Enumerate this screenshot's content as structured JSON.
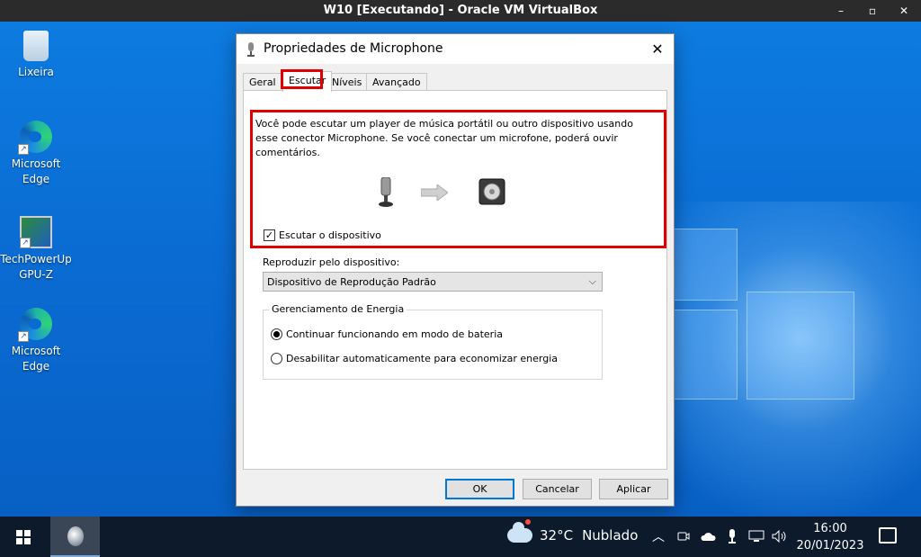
{
  "vbox": {
    "title": "W10 [Executando] - Oracle VM VirtualBox",
    "minimize": "–",
    "maximize": "▫",
    "close": "✕"
  },
  "desktop": {
    "icons": [
      {
        "label": "Lixeira",
        "icon": "recycle-bin-icon"
      },
      {
        "label": "Microsoft Edge",
        "icon": "edge-icon"
      },
      {
        "label": "TechPowerUp GPU-Z",
        "icon": "gpuz-icon"
      },
      {
        "label": "Microsoft Edge",
        "icon": "edge-icon"
      }
    ]
  },
  "dialog": {
    "title": "Propriedades de Microphone",
    "close": "✕",
    "tabs": [
      {
        "label": "Geral",
        "active": false
      },
      {
        "label": "Escutar",
        "active": true
      },
      {
        "label": "Níveis",
        "active": false
      },
      {
        "label": "Avançado",
        "active": false
      }
    ],
    "description": "Você pode escutar um player de música portátil ou outro dispositivo usando esse conector Microphone. Se você conectar um microfone, poderá ouvir comentários.",
    "listen_checkbox": {
      "label": "Escutar o dispositivo",
      "checked": true,
      "mark": "✓"
    },
    "playback_label": "Reproduzir pelo dispositivo:",
    "playback_select": {
      "value": "Dispositivo de Reprodução Padrão",
      "chevron": "⌵"
    },
    "power_group": {
      "legend": "Gerenciamento de Energia",
      "options": [
        {
          "label": "Continuar funcionando em modo de bateria",
          "selected": true
        },
        {
          "label": "Desabilitar automaticamente para economizar energia",
          "selected": false
        }
      ]
    },
    "buttons": {
      "ok": "OK",
      "cancel": "Cancelar",
      "apply": "Aplicar"
    }
  },
  "taskbar": {
    "weather": {
      "temp": "32°C",
      "condition": "Nublado"
    },
    "tray": {
      "chevron": "︿"
    },
    "clock": {
      "time": "16:00",
      "date": "20/01/2023"
    }
  },
  "colors": {
    "highlight": "#e00000",
    "accent": "#0078d7"
  }
}
